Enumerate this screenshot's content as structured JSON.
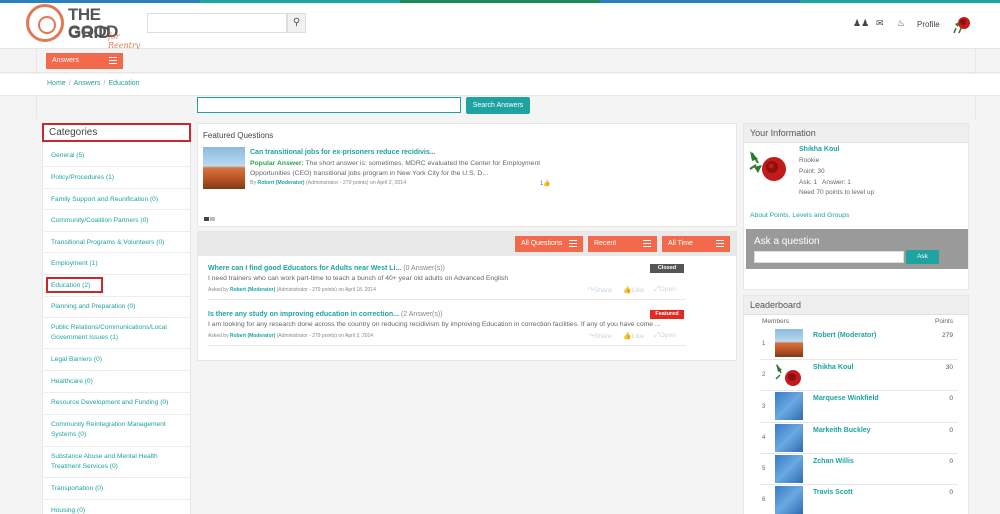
{
  "colors": {
    "accent": "#f26a4b",
    "teal": "#1fa3a0",
    "highlight": "#c9282d",
    "closed": "#555555",
    "featured": "#e02b20"
  },
  "brand": {
    "line1": "THE GOOD",
    "line2": "GRID",
    "tagline": "for Reentry"
  },
  "header": {
    "search_icon": "search-icon",
    "profile": "Profile"
  },
  "toolbar": {
    "answers": "Answers"
  },
  "breadcrumb": [
    "Home",
    "Answers",
    "Education"
  ],
  "search": {
    "button": "Search Answers"
  },
  "categories": {
    "title": "Categories",
    "items": [
      "General (5)",
      "Policy/Procedures (1)",
      "Family Support and Reunification (0)",
      "Community/Coalition Partners (0)",
      "Transitional Programs & Volunteers (0)",
      "Employment (1)",
      "Education (2)",
      "Planning and Preparation (0)",
      "Public Relations/Communications/Local Government Issues (1)",
      "Legal Barriers (0)",
      "Healthcare (0)",
      "Resource Development and Funding (0)",
      "Community Reintegration Management Systems (0)",
      "Substance Abuse and Mental Health Treatment Services (0)",
      "Transportation (0)",
      "Housing (0)"
    ]
  },
  "featured": {
    "title": "Featured Questions",
    "question": "Can transitional jobs for ex-prisoners reduce recidivis...",
    "answer_label": "Popular Answer:",
    "answer": "The short answer is: sometimes. MDRC evaluated the Center for Employment Opportunities (CEO) transitional jobs program in New York City for the U.S. D...",
    "by": "By",
    "author": "Robert (Moderator)",
    "meta": "(Administrator - 279 points) on April 2, 2014",
    "likes": "1"
  },
  "filters": {
    "all_questions": "All Questions",
    "recent": "Recent",
    "all_time": "All Time"
  },
  "questions": [
    {
      "title": "Where can I find good Educators for Adults near West Li...",
      "count": "(0 Answer(s))",
      "desc": "I need trainers who can work part-time to teach a bunch of 40+ year old adults on Advanced English",
      "asked": "Asked by",
      "author": "Robert (Moderator)",
      "meta": "(Administrator - 279 points) on April 18, 2014",
      "badge": "Closed",
      "share": "Share",
      "like": "Like",
      "open": "Open"
    },
    {
      "title": "Is there any study on improving education in correction...",
      "count": "(2 Answer(s))",
      "desc": "I am looking for any research done across the country on reducing recidivism by improving Education in correction facilities. If any of you have come ...",
      "asked": "Asked by",
      "author": "Robert (Moderator)",
      "meta": "(Administrator - 279 points) on April 2, 2014",
      "badge": "Featured",
      "share": "Share",
      "like": "Like",
      "open": "Open"
    }
  ],
  "your_info": {
    "title": "Your Information",
    "name": "Shikha Koul",
    "rank": "Rookie",
    "point": "Point: 30",
    "ask": "Ask: 1",
    "answer": "Answer: 1",
    "need": "Need 70 points to level up",
    "about": "About Points, Levels and Groups"
  },
  "ask": {
    "title": "Ask a question",
    "button": "Ask"
  },
  "leaderboard": {
    "title": "Leaderboard",
    "col_members": "Members",
    "col_points": "Points",
    "rows": [
      {
        "rank": "1",
        "name": "Robert (Moderator)",
        "points": "279"
      },
      {
        "rank": "2",
        "name": "Shikha Koul",
        "points": "30"
      },
      {
        "rank": "3",
        "name": "Marquese Winkfield",
        "points": "0"
      },
      {
        "rank": "4",
        "name": "Markeith Buckley",
        "points": "0"
      },
      {
        "rank": "5",
        "name": "Zchan Willis",
        "points": "0"
      },
      {
        "rank": "6",
        "name": "Travis Scott",
        "points": "0"
      }
    ]
  }
}
